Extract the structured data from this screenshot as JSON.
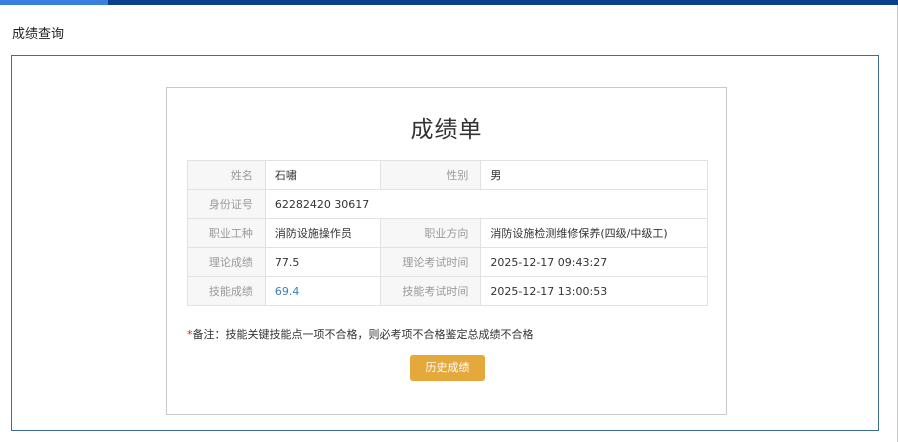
{
  "header": {
    "title": "成绩查询"
  },
  "card": {
    "title": "成绩单",
    "rows": [
      {
        "label1": "姓名",
        "value1": "石嘯",
        "label2": "性别",
        "value2": "男"
      },
      {
        "label1": "身份证号",
        "value1": "62282420      30617"
      },
      {
        "label1": "职业工种",
        "value1": "消防设施操作员",
        "label2": "职业方向",
        "value2": "消防设施检测维修保养(四级/中级工)"
      },
      {
        "label1": "理论成绩",
        "value1": "77.5",
        "label2": "理论考试时间",
        "value2": "2025-12-17 09:43:27"
      },
      {
        "label1": "技能成绩",
        "value1": "69.4",
        "label2": "技能考试时间",
        "value2": "2025-12-17 13:00:53"
      }
    ],
    "note_star": "*",
    "note_text": "备注：技能关键技能点一项不合格，则必考项不合格鉴定总成绩不合格",
    "history_button": "历史成绩"
  },
  "colors": {
    "top_bar": "#0a3f8f",
    "button": "#e4a83b",
    "link": "#3a7fc0"
  }
}
